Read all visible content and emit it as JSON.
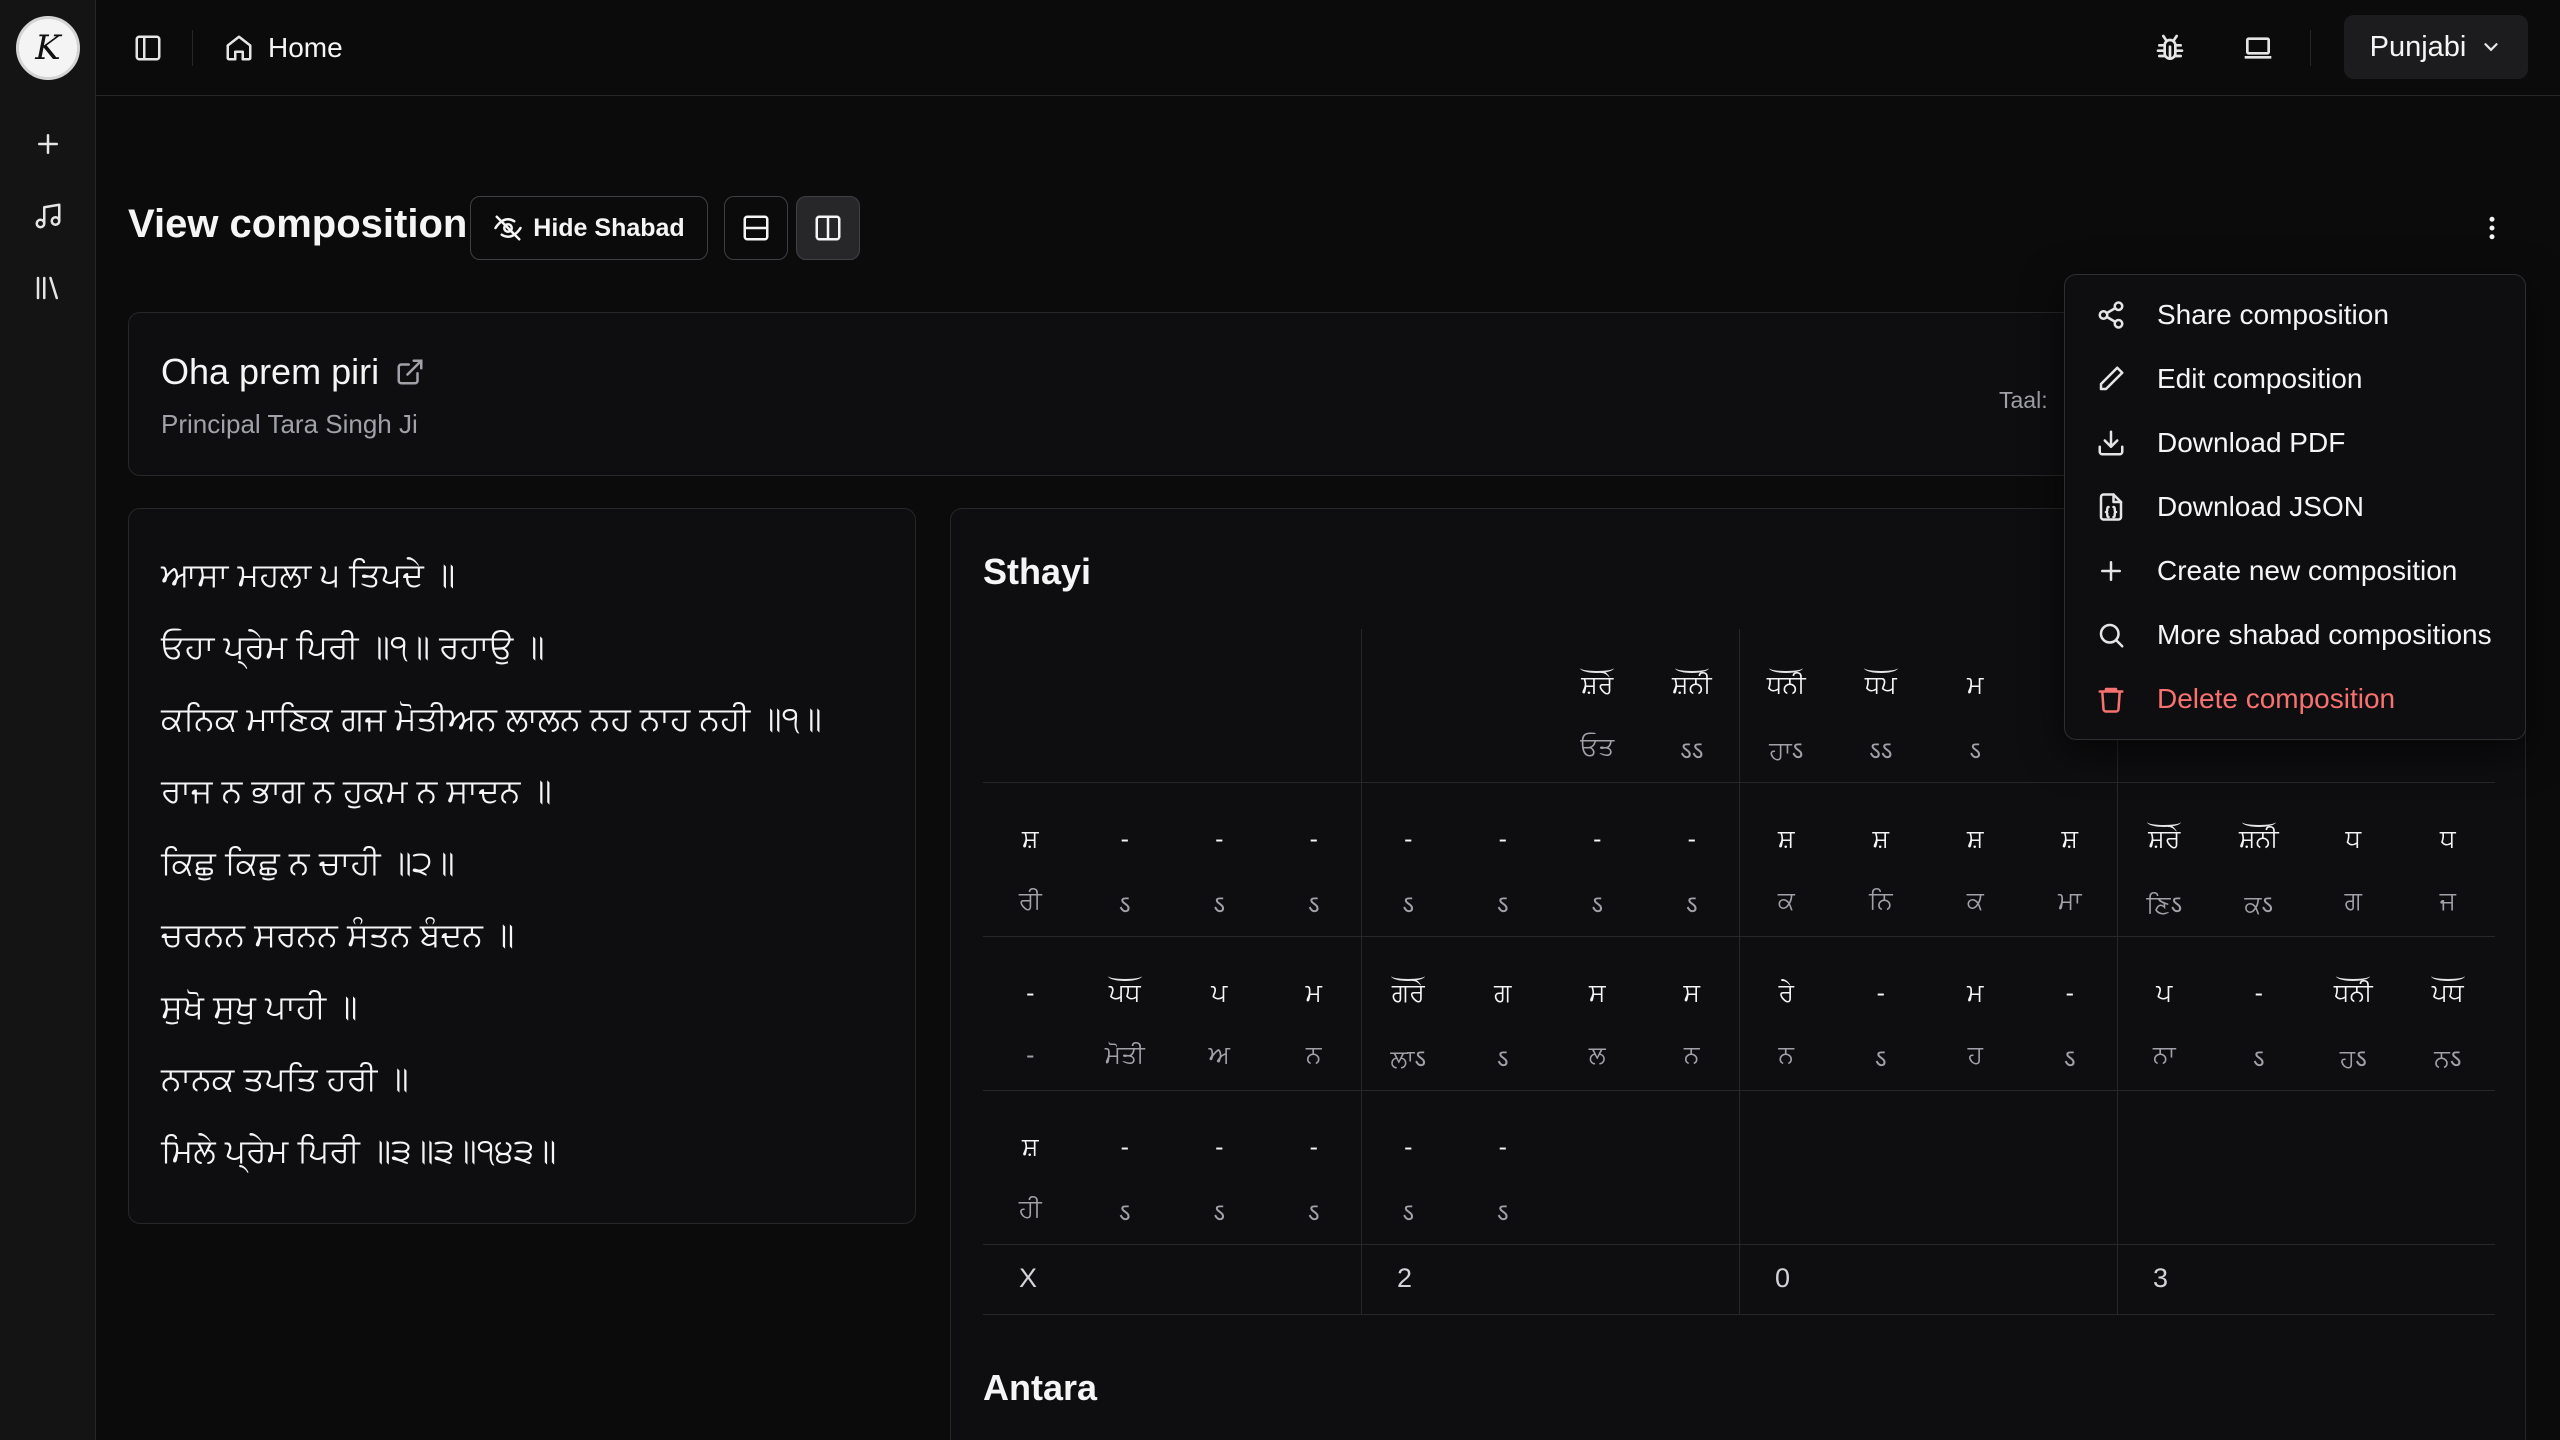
{
  "sidebar": {
    "logo_letter": "K",
    "items": [
      {
        "name": "add",
        "icon": "plus-icon"
      },
      {
        "name": "music",
        "icon": "music-icon"
      },
      {
        "name": "library",
        "icon": "library-icon"
      }
    ]
  },
  "topbar": {
    "breadcrumb": "Home",
    "language": "Punjabi"
  },
  "header": {
    "title": "View composition",
    "hide_shabad_label": "Hide Shabad"
  },
  "composition": {
    "title": "Oha prem piri",
    "author": "Principal Tara Singh Ji",
    "taal_label": "Taal:"
  },
  "shabad": {
    "lines": [
      "ਆਸਾ ਮਹਲਾ ੫ ਤਿਪਦੇ ॥",
      "ਓਹਾ ਪ੍ਰੇਮ ਪਿਰੀ ॥੧॥ ਰਹਾਉ ॥",
      "ਕਨਿਕ ਮਾਣਿਕ ਗਜ ਮੋਤੀਅਨ ਲਾਲਨ ਨਹ ਨਾਹ ਨਹੀ ॥੧॥",
      "ਰਾਜ ਨ ਭਾਗ ਨ ਹੁਕਮ ਨ ਸਾਦਨ ॥",
      "ਕਿਛੁ ਕਿਛੁ ਨ ਚਾਹੀ ॥੨॥",
      "ਚਰਨਨ ਸਰਨਨ ਸੰਤਨ ਬੰਦਨ ॥",
      "ਸੁਖੋ ਸੁਖੁ ਪਾਹੀ ॥",
      "ਨਾਨਕ ਤਪਤਿ ਹਰੀ ॥",
      "ਮਿਲੇ ਪ੍ਰੇਮ ਪਿਰੀ ॥੩॥੩॥੧੪੩॥"
    ]
  },
  "sthayi": {
    "title": "Sthayi",
    "rows": [
      [
        {
          "s": "",
          "b": ""
        },
        {
          "s": "",
          "b": ""
        },
        {
          "s": "",
          "b": ""
        },
        {
          "s": "",
          "b": ""
        },
        {
          "s": "",
          "b": ""
        },
        {
          "s": "",
          "b": ""
        },
        {
          "s": "ਸ਼ਰੇ",
          "b": "ਓਤ",
          "arc": true
        },
        {
          "s": "ਸ਼ਨੀ",
          "b": "ऽऽ",
          "arc": true
        },
        {
          "s": "ਧਨੀ",
          "b": "ਹਾऽ",
          "arc": true
        },
        {
          "s": "ਧਪ",
          "b": "ऽऽ",
          "arc": true
        },
        {
          "s": "ਮ",
          "b": "ऽ"
        },
        {
          "s": "",
          "b": ""
        },
        {
          "s": "",
          "b": ""
        },
        {
          "s": "",
          "b": ""
        },
        {
          "s": "",
          "b": ""
        },
        {
          "s": "",
          "b": ""
        }
      ],
      [
        {
          "s": "ਸ਼",
          "b": "ਰੀ"
        },
        {
          "s": "-",
          "b": "ऽ"
        },
        {
          "s": "-",
          "b": "ऽ"
        },
        {
          "s": "-",
          "b": "ऽ"
        },
        {
          "s": "-",
          "b": "ऽ"
        },
        {
          "s": "-",
          "b": "ऽ"
        },
        {
          "s": "-",
          "b": "ऽ"
        },
        {
          "s": "-",
          "b": "ऽ"
        },
        {
          "s": "ਸ਼",
          "b": "ਕ"
        },
        {
          "s": "ਸ਼",
          "b": "ਨਿ"
        },
        {
          "s": "ਸ਼",
          "b": "ਕ"
        },
        {
          "s": "ਸ਼",
          "b": "ਮਾ"
        },
        {
          "s": "ਸ਼ਰੇ",
          "b": "ਣਿऽ",
          "arc": true
        },
        {
          "s": "ਸ਼ਨੀ",
          "b": "ਕऽ",
          "arc": true
        },
        {
          "s": "ਧ",
          "b": "ਗ"
        },
        {
          "s": "ਧ",
          "b": "ਜ"
        }
      ],
      [
        {
          "s": "-",
          "b": "-"
        },
        {
          "s": "ਪਧ",
          "b": "ਮੋਤੀ",
          "arc": true
        },
        {
          "s": "ਪ",
          "b": "ਅ"
        },
        {
          "s": "ਮ",
          "b": "ਨ"
        },
        {
          "s": "ਗਰੇ",
          "b": "ਲਾऽ",
          "arc": true
        },
        {
          "s": "ਗ",
          "b": "ऽ"
        },
        {
          "s": "ਸ",
          "b": "ਲ"
        },
        {
          "s": "ਸ",
          "b": "ਨ"
        },
        {
          "s": "ਰੇ",
          "b": "ਨ"
        },
        {
          "s": "-",
          "b": "ऽ"
        },
        {
          "s": "ਮ",
          "b": "ਹ"
        },
        {
          "s": "-",
          "b": "ऽ"
        },
        {
          "s": "ਪ",
          "b": "ਨਾ"
        },
        {
          "s": "-",
          "b": "ऽ"
        },
        {
          "s": "ਧਨੀ",
          "b": "ਹऽ",
          "arc": true
        },
        {
          "s": "ਪਧ",
          "b": "ਨऽ",
          "arc": true
        }
      ],
      [
        {
          "s": "ਸ਼",
          "b": "ਹੀ"
        },
        {
          "s": "-",
          "b": "ऽ"
        },
        {
          "s": "-",
          "b": "ऽ"
        },
        {
          "s": "-",
          "b": "ऽ"
        },
        {
          "s": "-",
          "b": "ऽ"
        },
        {
          "s": "-",
          "b": "ऽ"
        },
        {
          "s": "",
          "b": ""
        },
        {
          "s": "",
          "b": ""
        },
        {
          "s": "",
          "b": ""
        },
        {
          "s": "",
          "b": ""
        },
        {
          "s": "",
          "b": ""
        },
        {
          "s": "",
          "b": ""
        },
        {
          "s": "",
          "b": ""
        },
        {
          "s": "",
          "b": ""
        },
        {
          "s": "",
          "b": ""
        },
        {
          "s": "",
          "b": ""
        }
      ]
    ],
    "taali": [
      "X",
      "2",
      "0",
      "3"
    ]
  },
  "antara": {
    "title": "Antara"
  },
  "menu": {
    "items": [
      {
        "label": "Share composition",
        "icon": "share-icon"
      },
      {
        "label": "Edit composition",
        "icon": "pencil-icon"
      },
      {
        "label": "Download PDF",
        "icon": "download-icon"
      },
      {
        "label": "Download JSON",
        "icon": "file-json-icon"
      },
      {
        "label": "Create new composition",
        "icon": "plus-icon"
      },
      {
        "label": "More shabad compositions",
        "icon": "search-icon"
      },
      {
        "label": "Delete composition",
        "icon": "trash-icon"
      }
    ],
    "danger_color": "#f87171"
  }
}
